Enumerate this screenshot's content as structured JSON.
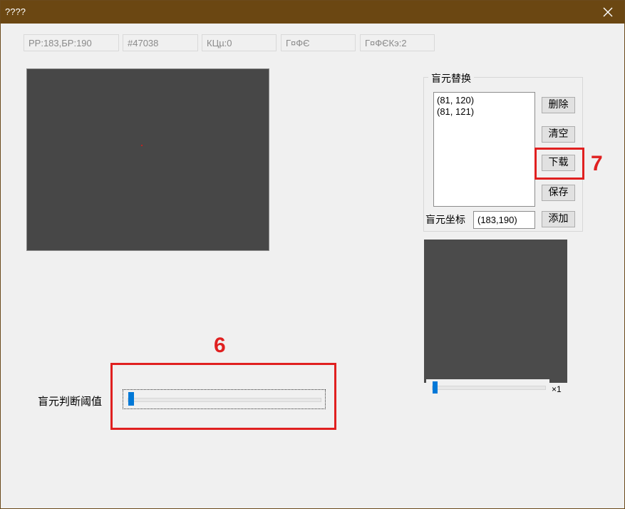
{
  "window": {
    "title": "????"
  },
  "status": {
    "fields": [
      "PP:183,БP:190",
      "#47038",
      "КЦµ:0",
      "Г¤ФЄ",
      "Г¤ФЄКэ:2"
    ]
  },
  "replace_group": {
    "title": "盲元替换",
    "list_items": [
      "(81, 120)",
      "(81, 121)"
    ],
    "delete_label": "删除",
    "clear_label": "清空",
    "download_label": "下载",
    "save_label": "保存",
    "add_label": "添加",
    "coord_label": "盲元坐标",
    "coord_value": "(183,190)"
  },
  "zoom": {
    "label": "×1",
    "level": 0
  },
  "threshold": {
    "label": "盲元判断阈值",
    "level": 0
  },
  "annotations": {
    "seven": "7",
    "six": "6"
  },
  "colors": {
    "annotation": "#e02020",
    "titlebar": "#6b4712",
    "slider_thumb": "#0078d7"
  }
}
